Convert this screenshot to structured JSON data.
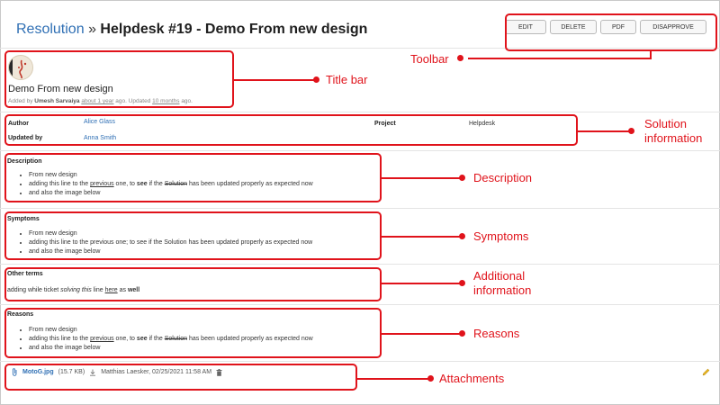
{
  "header": {
    "breadcrumb_root": "Resolution",
    "separator": "»",
    "title": "Helpdesk #19 - Demo From new design"
  },
  "toolbar": {
    "edit": "EDIT",
    "delete": "DELETE",
    "pdf": "PDF",
    "disapprove": "DISAPPROVE"
  },
  "record": {
    "title": "Demo From new design",
    "meta": {
      "added_by_prefix": "Added by",
      "added_by": "Umesh Sarvaiya",
      "added_when": "about 1 year",
      "ago_updated": "ago. Updated",
      "updated_when": "10 months",
      "ago": "ago."
    }
  },
  "info": {
    "author_label": "Author",
    "author": "Alice Glass",
    "updated_by_label": "Updated by",
    "updated_by": "Anna Smith",
    "project_label": "Project",
    "project": "Helpdesk"
  },
  "sections": {
    "description": {
      "title": "Description",
      "item1": "From new design",
      "item2_a": "adding this line to the",
      "item2_b": "previous",
      "item2_c": "one, to",
      "item2_d": "see",
      "item2_e": "if the",
      "item2_f": "Solution",
      "item2_g": "has been updated properly as expected now",
      "item3": "and also the image below"
    },
    "symptoms": {
      "title": "Symptoms",
      "item1": "From new design",
      "item2": "adding this line to the previous one; to see if the Solution has been updated properly as expected now",
      "item3": "and also the image below"
    },
    "other_terms": {
      "title": "Other terms",
      "a": "adding while ticket",
      "b": "solving this",
      "c": "line",
      "d": "here",
      "e": "as",
      "f": "well"
    },
    "reasons": {
      "title": "Reasons",
      "item1": "From new design",
      "item2_a": "adding this line to the",
      "item2_b": "previous",
      "item2_c": "one, to",
      "item2_d": "see",
      "item2_e": "if the",
      "item2_f": "Solution",
      "item2_g": "has been updated properly as expected now",
      "item3": "and also the image below"
    }
  },
  "attachment": {
    "filename": "MotoG.jpg",
    "size": "(15.7 KB)",
    "uploader": "Matthias Laesker, 02/25/2021 11:58 AM"
  },
  "annotations": {
    "toolbar": "Toolbar",
    "title_bar": "Title bar",
    "solution_info_1": "Solution",
    "solution_info_2": "information",
    "description": "Description",
    "symptoms": "Symptoms",
    "additional_1": "Additional",
    "additional_2": "information",
    "reasons": "Reasons",
    "attachments": "Attachments"
  },
  "icons": [
    "paperclip-icon",
    "download-icon",
    "trash-icon",
    "pencil-icon"
  ],
  "colors": {
    "annotation": "#e0131b",
    "link": "#2f6fb4"
  }
}
